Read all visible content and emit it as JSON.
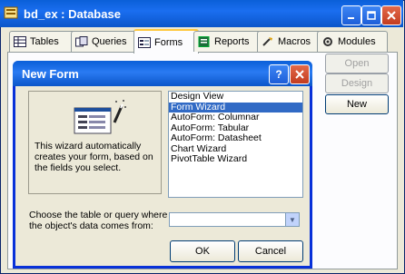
{
  "window": {
    "title": "bd_ex : Database"
  },
  "tabs": [
    {
      "label": "Tables",
      "icon": "table-icon"
    },
    {
      "label": "Queries",
      "icon": "query-icon"
    },
    {
      "label": "Forms",
      "icon": "form-icon"
    },
    {
      "label": "Reports",
      "icon": "report-icon"
    },
    {
      "label": "Macros",
      "icon": "macro-icon"
    },
    {
      "label": "Modules",
      "icon": "module-icon"
    }
  ],
  "side_buttons": {
    "open": "Open",
    "design": "Design",
    "new": "New"
  },
  "dialog": {
    "title": "New Form",
    "description": "This wizard automatically creates your form, based on the fields you select.",
    "options": [
      "Design View",
      "Form Wizard",
      "AutoForm: Columnar",
      "AutoForm: Tabular",
      "AutoForm: Datasheet",
      "Chart Wizard",
      "PivotTable Wizard"
    ],
    "selected_option": "Form Wizard",
    "source_label": "Choose the table or query where the object's data comes from:",
    "source_value": "",
    "ok_label": "OK",
    "cancel_label": "Cancel"
  }
}
